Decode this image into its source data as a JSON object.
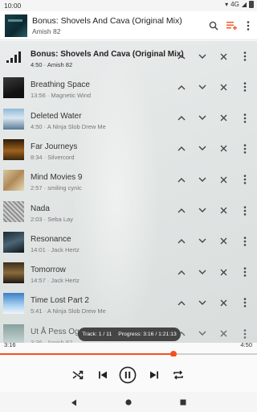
{
  "status_bar": {
    "time": "10:00",
    "network": "4G"
  },
  "now_playing": {
    "title": "Bonus: Shovels And Cava (Original Mix)",
    "artist": "Amish 82"
  },
  "queue": [
    {
      "title": "Bonus: Shovels And Cava (Original Mix)",
      "meta": "4:50 · Amish 82",
      "current": true
    },
    {
      "title": "Breathing Space",
      "meta": "13:56 · Magnetic Wind",
      "art": "art-dark"
    },
    {
      "title": "Deleted Water",
      "meta": "4:50 · A Ninja Slob Drew Me",
      "art": "art-sky"
    },
    {
      "title": "Far Journeys",
      "meta": "8:34 · Silvercord",
      "art": "art-amber"
    },
    {
      "title": "Mind Movies 9",
      "meta": "2:57 · smiling cynic",
      "art": "art-sepia"
    },
    {
      "title": "Nada",
      "meta": "2:03 · Seba Lay",
      "art": "art-gray"
    },
    {
      "title": "Resonance",
      "meta": "14:01 · Jack Hertz",
      "art": "art-wave"
    },
    {
      "title": "Tomorrow",
      "meta": "14:57 · Jack Hertz",
      "art": "art-night"
    },
    {
      "title": "Time Lost Part 2",
      "meta": "5:41 · A Ninja Slob Drew Me",
      "art": "art-blue"
    },
    {
      "title": "Ut Å Pess Og In…",
      "meta": "3:36 · Amish 82",
      "art": "art-fade"
    }
  ],
  "toast": {
    "track": "Track: 1 / 11",
    "progress": "Progress: 3:16 / 1:21:13"
  },
  "playback": {
    "elapsed": "3:16",
    "duration": "4:50",
    "progress_fraction": 0.674
  },
  "colors": {
    "accent": "#f4511e"
  },
  "icons": {
    "header": [
      "search-icon",
      "queue-icon",
      "more-vertical-icon"
    ],
    "row": [
      "chevron-up-icon",
      "chevron-down-icon",
      "close-icon",
      "more-vertical-icon"
    ],
    "controls": [
      "shuffle-icon",
      "skip-previous-icon",
      "pause-icon",
      "skip-next-icon",
      "repeat-icon"
    ],
    "nav": [
      "back-icon",
      "home-icon",
      "recents-icon"
    ]
  }
}
